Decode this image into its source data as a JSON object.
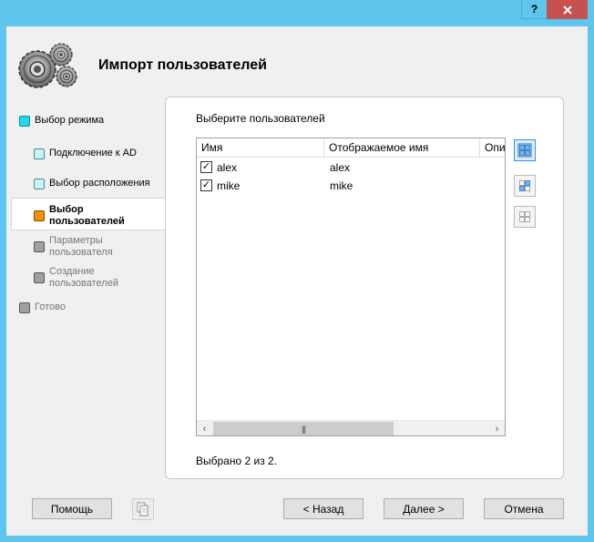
{
  "window": {
    "help_label": "?",
    "close_label": "X"
  },
  "header": {
    "title": "Импорт пользователей",
    "logo_icon": "gears-icon"
  },
  "steps": [
    {
      "label": "Выбор режима",
      "state": "done",
      "color": "#22d8e8"
    },
    {
      "label": "Подключение к AD",
      "state": "done",
      "color": "#c8f4f6"
    },
    {
      "label": "Выбор расположения",
      "state": "done",
      "color": "#c8f4f6"
    },
    {
      "label_line1": "Выбор",
      "label_line2": "пользователей",
      "state": "active",
      "color": "#f29010"
    },
    {
      "label_line1": "Параметры",
      "label_line2": "пользователя",
      "state": "pending",
      "color": "#a0a0a0"
    },
    {
      "label_line1": "Создание",
      "label_line2": "пользователей",
      "state": "pending",
      "color": "#a0a0a0"
    },
    {
      "label": "Готово",
      "state": "pending",
      "color": "#a0a0a0"
    }
  ],
  "main": {
    "label": "Выберите пользователей",
    "columns": [
      "Имя",
      "Отображаемое имя",
      "Опи"
    ],
    "rows": [
      {
        "checked": true,
        "name": "alex",
        "display_name": "alex"
      },
      {
        "checked": true,
        "name": "mike",
        "display_name": "mike"
      }
    ],
    "status": "Выбрано 2 из 2.",
    "side_buttons": [
      "select-all-icon",
      "invert-selection-icon",
      "deselect-all-icon"
    ]
  },
  "footer": {
    "help_label": "Помощь",
    "back_label": "< Назад",
    "next_label": "Далее >",
    "cancel_label": "Отмена",
    "copy_icon": "copy-icon"
  }
}
